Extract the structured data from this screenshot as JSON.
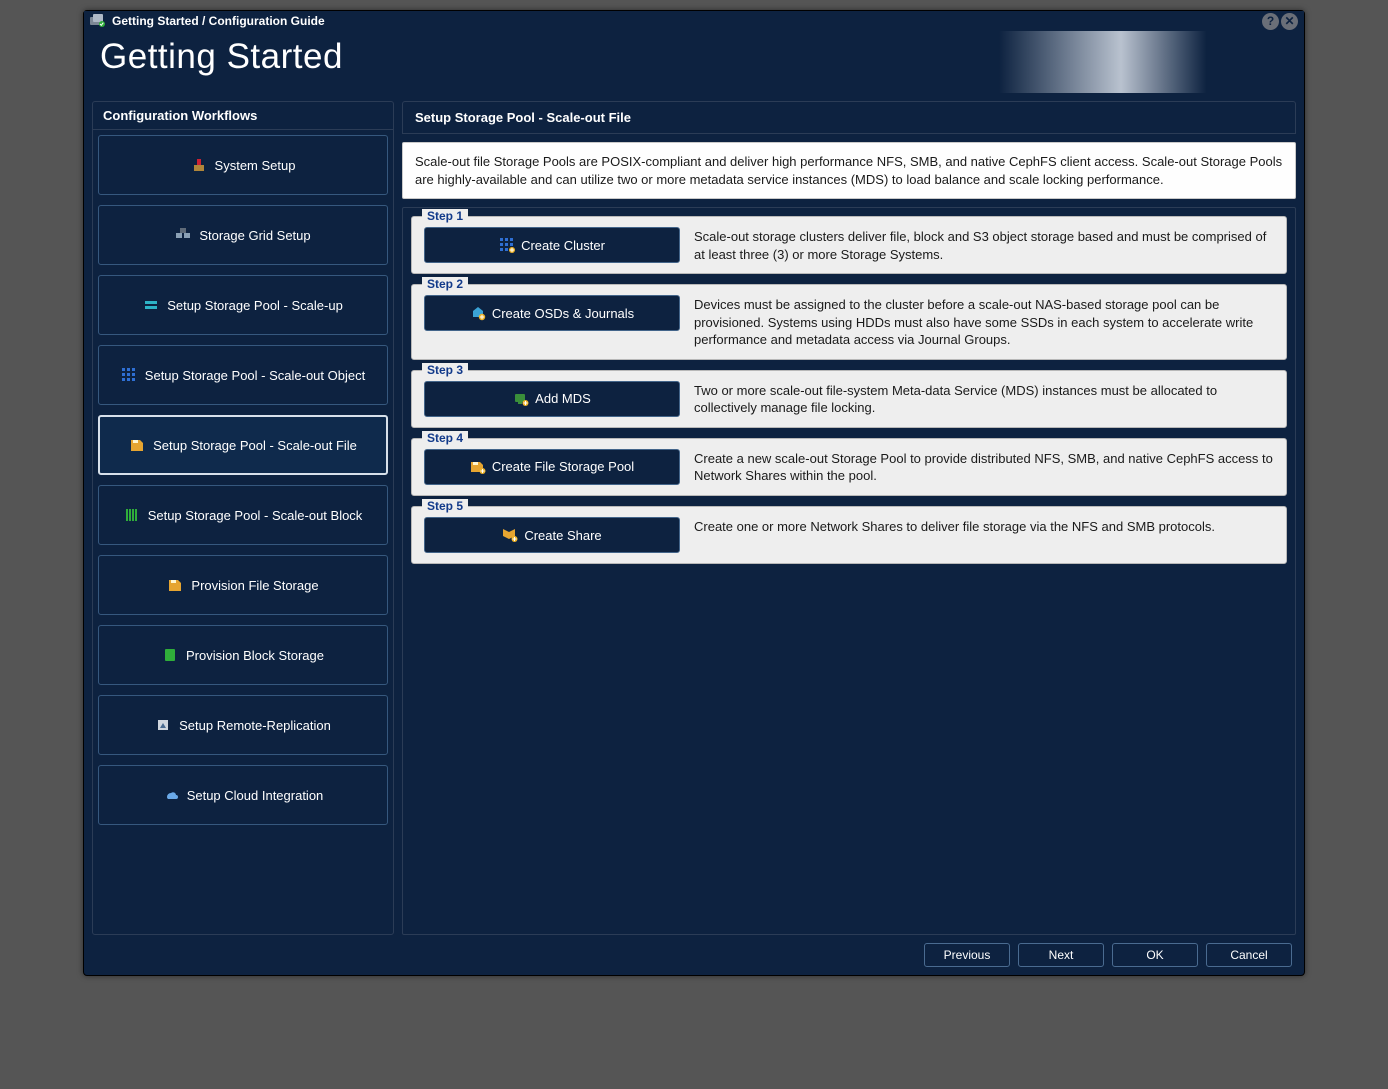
{
  "window": {
    "title": "Getting Started / Configuration Guide"
  },
  "hero": {
    "title": "Getting Started"
  },
  "sidebar": {
    "header": "Configuration Workflows",
    "items": [
      {
        "label": "System Setup",
        "icon_fill": "#b0863a"
      },
      {
        "label": "Storage Grid Setup",
        "icon_fill": "#8aa0b5"
      },
      {
        "label": "Setup Storage Pool - Scale-up",
        "icon_fill": "#2db3c7"
      },
      {
        "label": "Setup Storage Pool - Scale-out Object",
        "icon_fill": "#2e6fd4"
      },
      {
        "label": "Setup Storage Pool - Scale-out File",
        "icon_fill": "#e6a531"
      },
      {
        "label": "Setup Storage Pool - Scale-out Block",
        "icon_fill": "#2fae3a"
      },
      {
        "label": "Provision File Storage",
        "icon_fill": "#e6a531"
      },
      {
        "label": "Provision Block Storage",
        "icon_fill": "#2fae3a"
      },
      {
        "label": "Setup Remote-Replication",
        "icon_fill": "#cfd6de"
      },
      {
        "label": "Setup Cloud Integration",
        "icon_fill": "#6aa9e8"
      }
    ],
    "selected_index": 4
  },
  "main": {
    "header": "Setup Storage Pool - Scale-out File",
    "intro": "Scale-out file Storage Pools are POSIX-compliant and deliver high performance NFS, SMB, and native CephFS client access. Scale-out Storage Pools are highly-available and can utilize two or more metadata service instances (MDS) to load balance and scale locking performance.",
    "steps": [
      {
        "legend": "Step 1",
        "button": "Create Cluster",
        "desc": "Scale-out storage clusters deliver file, block and S3 object storage based and must be comprised of at least three (3) or more Storage Systems.",
        "icon_fill": "#2e6fd4"
      },
      {
        "legend": "Step 2",
        "button": "Create OSDs & Journals",
        "desc": "Devices must be assigned to the cluster before a scale-out NAS-based storage pool can be provisioned. Systems using HDDs must also have some SSDs in each system to accelerate write performance and metadata access via Journal Groups.",
        "icon_fill": "#3aa3d6"
      },
      {
        "legend": "Step 3",
        "button": "Add MDS",
        "desc": "Two or more scale-out file-system Meta-data Service (MDS) instances must be allocated to collectively manage file locking.",
        "icon_fill": "#3a8f3a"
      },
      {
        "legend": "Step 4",
        "button": "Create File Storage Pool",
        "desc": "Create a new scale-out Storage Pool to provide distributed NFS, SMB, and native CephFS access to Network Shares within the pool.",
        "icon_fill": "#e6a531"
      },
      {
        "legend": "Step 5",
        "button": "Create Share",
        "desc": "Create one or more Network Shares to deliver file storage via the NFS and SMB protocols.",
        "icon_fill": "#e6a531"
      }
    ]
  },
  "footer": {
    "previous": "Previous",
    "next": "Next",
    "ok": "OK",
    "cancel": "Cancel"
  }
}
